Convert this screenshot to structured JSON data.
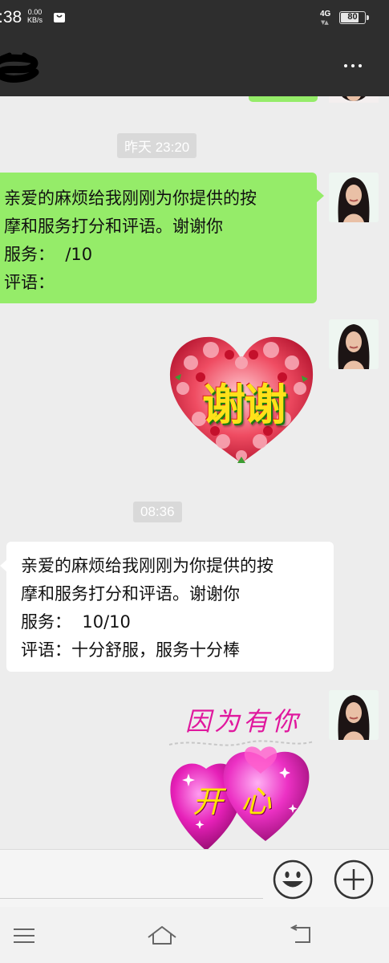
{
  "status_bar": {
    "time": ":38",
    "speed_value": "0.00",
    "speed_unit": "KB/s",
    "network": "4G",
    "battery": "80",
    "battery_level": 0.8
  },
  "header": {
    "more_icon": "more-dots-icon"
  },
  "chat": {
    "timestamps": [
      "昨天 23:20",
      "08:36"
    ],
    "messages": [
      {
        "side": "right",
        "lines": [
          "亲爱的麻烦给我刚刚为你提供的按",
          "摩和服务打分和评语。谢谢你",
          "服务：  /10",
          "评语："
        ]
      },
      {
        "side": "left",
        "lines": [
          "亲爱的麻烦给我刚刚为你提供的按",
          "摩和服务打分和评语。谢谢你",
          "服务：  10/10",
          "评语：十分舒服，服务十分棒"
        ]
      }
    ],
    "stickers": [
      {
        "text": "谢谢"
      },
      {
        "text_top": "因为有你",
        "text_bottom": "开心"
      }
    ]
  },
  "input_bar": {
    "emoji_icon": "emoji-icon",
    "plus_icon": "plus-icon"
  },
  "nav_bar": {
    "menu_icon": "menu-icon",
    "home_icon": "home-icon",
    "back_icon": "back-icon"
  },
  "colors": {
    "bubble_green": "#95ec69",
    "chat_background": "#ededed",
    "header_background": "#2e2e2e"
  }
}
